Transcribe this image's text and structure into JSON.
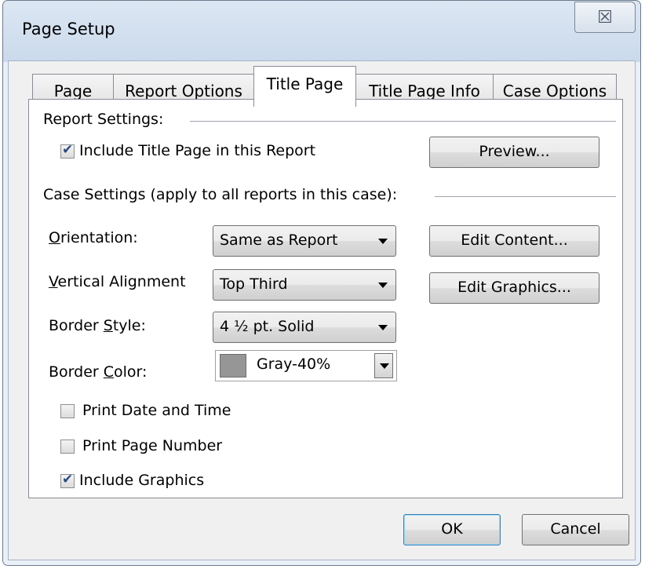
{
  "window": {
    "title": "Page Setup",
    "close_glyph": "☒"
  },
  "tabs": [
    {
      "label": "Page",
      "active": false
    },
    {
      "label": "Report Options",
      "active": false
    },
    {
      "label": "Title Page",
      "active": true
    },
    {
      "label": "Title Page Info",
      "active": false
    },
    {
      "label": "Case Options",
      "active": false
    }
  ],
  "report_settings": {
    "heading": "Report Settings:",
    "include_title_page": {
      "label": "Include Title Page in this Report",
      "checked": true
    },
    "preview_button": "Preview..."
  },
  "case_settings": {
    "heading": "Case Settings (apply to all reports in this case):",
    "orientation": {
      "accel": "O",
      "label_rest": "rientation:",
      "value": "Same as Report"
    },
    "vertical_alignment": {
      "accel": "V",
      "label_rest": "ertical Alignment",
      "value": "Top Third"
    },
    "border_style": {
      "label_pre": "Border ",
      "accel": "S",
      "label_rest": "tyle:",
      "value": "4 ½ pt. Solid"
    },
    "border_color": {
      "label_pre": "Border ",
      "accel": "C",
      "label_rest": "olor:",
      "value": "Gray-40%",
      "swatch_color": "#969696"
    },
    "edit_content_button": "Edit Content...",
    "edit_graphics_button": "Edit Graphics...",
    "print_date_time": {
      "label": "Print Date and Time",
      "checked": false
    },
    "print_page_number": {
      "label": "Print Page Number",
      "checked": false
    },
    "include_graphics": {
      "label": "Include Graphics",
      "checked": true
    }
  },
  "footer": {
    "ok": "OK",
    "cancel": "Cancel"
  },
  "icons": {
    "checkmark": "✔",
    "dropdown": "chevron-down-icon"
  }
}
